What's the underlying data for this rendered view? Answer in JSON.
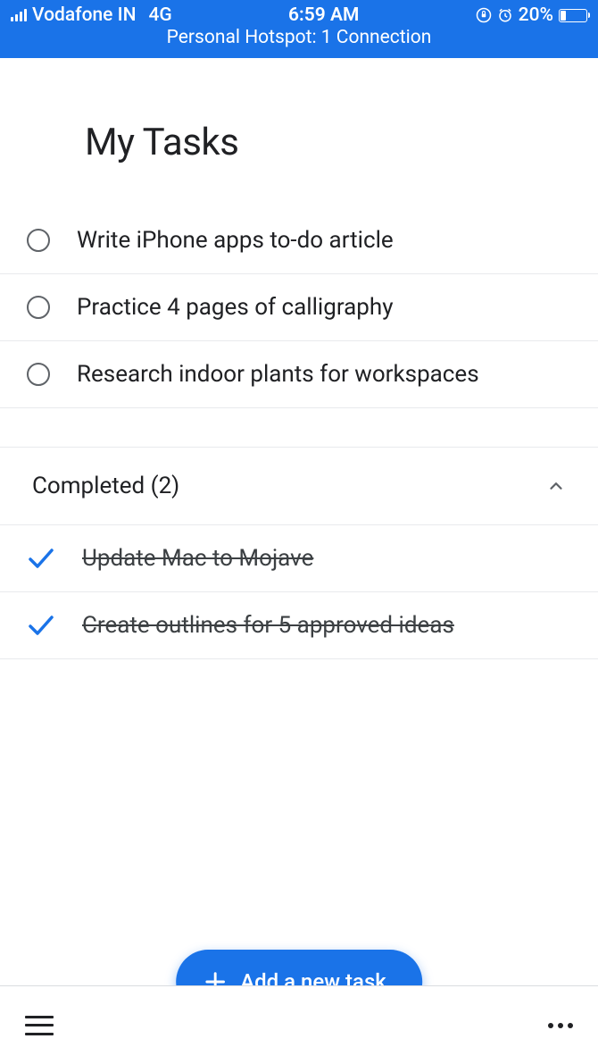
{
  "status_bar": {
    "carrier": "Vodafone IN",
    "network": "4G",
    "time": "6:59 AM",
    "battery_percent": "20%",
    "hotspot": "Personal Hotspot: 1 Connection"
  },
  "page_title": "My Tasks",
  "tasks": [
    {
      "text": "Write iPhone apps to-do article"
    },
    {
      "text": "Practice 4 pages of calligraphy"
    },
    {
      "text": "Research indoor plants for workspaces"
    }
  ],
  "completed_section": {
    "label": "Completed (2)"
  },
  "completed_tasks": [
    {
      "text": "Update Mac to Mojave"
    },
    {
      "text": "Create outlines for 5 approved ideas"
    }
  ],
  "fab_label": "Add a new task"
}
